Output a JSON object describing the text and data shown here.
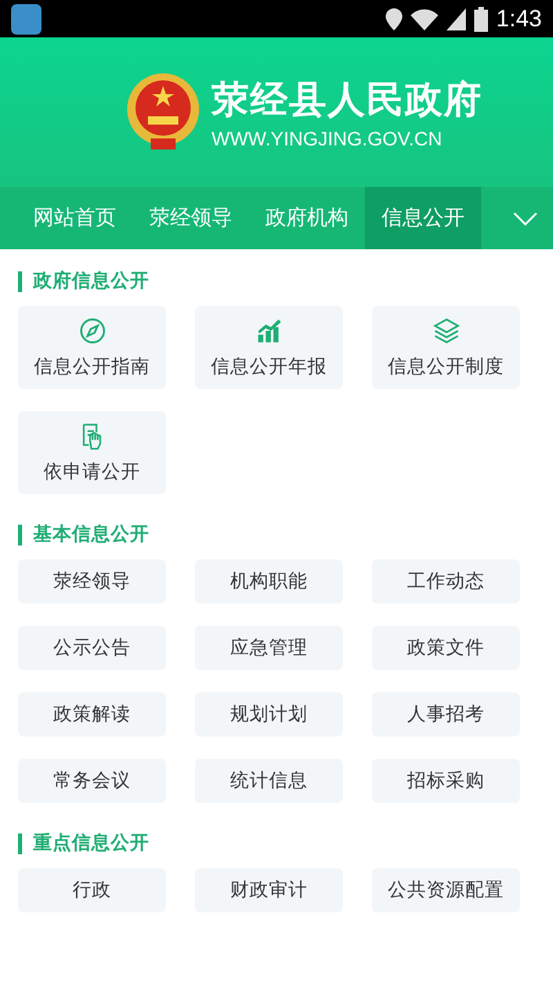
{
  "status_bar": {
    "time": "1:43"
  },
  "header": {
    "title": "荥经县人民政府",
    "url": "WWW.YINGJING.GOV.CN"
  },
  "nav": {
    "items": [
      {
        "label": "网站首页",
        "selected": false
      },
      {
        "label": "荥经领导",
        "selected": false
      },
      {
        "label": "政府机构",
        "selected": false
      },
      {
        "label": "信息公开",
        "selected": true
      }
    ]
  },
  "sections": [
    {
      "title": "政府信息公开",
      "items": [
        {
          "label": "信息公开指南",
          "kind": "compass"
        },
        {
          "label": "信息公开年报",
          "kind": "chart"
        },
        {
          "label": "信息公开制度",
          "kind": "layers"
        },
        {
          "label": "依申请公开",
          "kind": "hand"
        }
      ]
    },
    {
      "title": "基本信息公开",
      "items": [
        {
          "label": "荥经领导"
        },
        {
          "label": "机构职能"
        },
        {
          "label": "工作动态"
        },
        {
          "label": "公示公告"
        },
        {
          "label": "应急管理"
        },
        {
          "label": "政策文件"
        },
        {
          "label": "政策解读"
        },
        {
          "label": "规划计划"
        },
        {
          "label": "人事招考"
        },
        {
          "label": "常务会议"
        },
        {
          "label": "统计信息"
        },
        {
          "label": "招标采购"
        }
      ]
    },
    {
      "title": "重点信息公开",
      "items": [
        {
          "label": "行政"
        },
        {
          "label": "财政审计"
        },
        {
          "label": "公共资源配置"
        }
      ]
    }
  ]
}
